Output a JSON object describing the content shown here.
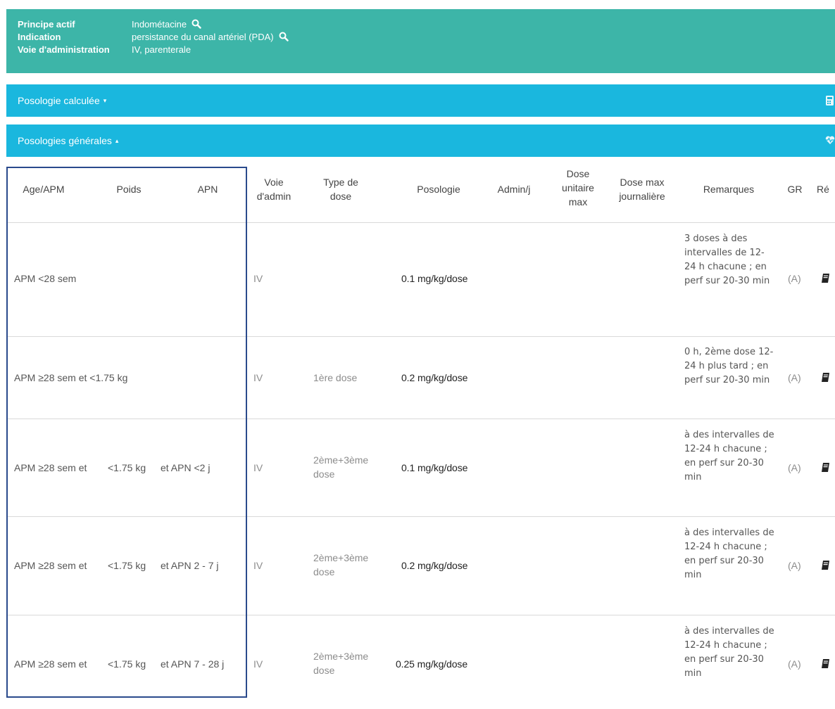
{
  "header": {
    "rows": [
      {
        "label": "Principe actif",
        "value": "Indométacine"
      },
      {
        "label": "Indication",
        "value": "persistance du canal artériel (PDA)"
      },
      {
        "label": "Voie d'administration",
        "value": "IV, parenterale"
      }
    ]
  },
  "panels": {
    "calc": {
      "label": "Posologie calculée",
      "caret": "▾"
    },
    "gen": {
      "label": "Posologies générales",
      "caret": "▴"
    }
  },
  "table": {
    "headers": {
      "age": "Age/APM",
      "poids": "Poids",
      "apn": "APN",
      "voie": "Voie d'admin",
      "type": "Type de dose",
      "posologie": "Posologie",
      "admin": "Admin/j",
      "dose_unit": "Dose unitaire max",
      "dose_max": "Dose max journalière",
      "remarques": "Remarques",
      "gr": "GR",
      "ref": "Ré"
    },
    "rows": [
      {
        "age": "APM <28 sem",
        "poids": "",
        "apn": "",
        "voie": "IV",
        "type": "",
        "posologie": "0.1 mg/kg/dose",
        "remarques": "3 doses à des intervalles de 12-24 h chacune ; en perf sur 20-30 min",
        "gr": "(A)"
      },
      {
        "age": "APM ≥28 sem et <1.75 kg",
        "poids": "",
        "apn": "",
        "voie": "IV",
        "type": "1ère dose",
        "posologie": "0.2 mg/kg/dose",
        "remarques": "0 h, 2ème dose 12-24 h plus tard ; en perf sur 20-30 min",
        "gr": "(A)"
      },
      {
        "age": "APM ≥28 sem et",
        "poids": "<1.75 kg",
        "apn": "et APN <2 j",
        "voie": "IV",
        "type": "2ème+3ème dose",
        "posologie": "0.1 mg/kg/dose",
        "remarques": "à des intervalles de 12-24 h chacune ; en perf sur 20-30 min",
        "gr": "(A)"
      },
      {
        "age": "APM ≥28 sem et",
        "poids": "<1.75 kg",
        "apn": "et APN 2 - 7 j",
        "voie": "IV",
        "type": "2ème+3ème dose",
        "posologie": "0.2 mg/kg/dose",
        "remarques": "à des intervalles de 12-24 h chacune ; en perf sur 20-30 min",
        "gr": "(A)"
      },
      {
        "age": "APM ≥28 sem et",
        "poids": "<1.75 kg",
        "apn": "et APN 7 - 28 j",
        "voie": "IV",
        "type": "2ème+3ème dose",
        "posologie": "0.25 mg/kg/dose",
        "remarques": "à des intervalles de 12-24 h chacune ; en perf sur 20-30 min",
        "gr": "(A)"
      }
    ]
  },
  "icons": {
    "search": "search-icon",
    "calculator": "calculator-icon",
    "heartbeat": "heartbeat-icon",
    "book": "book-icon"
  },
  "colors": {
    "header_bg": "#3db5a8",
    "bar_bg": "#1ab7de",
    "highlight_border": "#2a4a8c"
  }
}
